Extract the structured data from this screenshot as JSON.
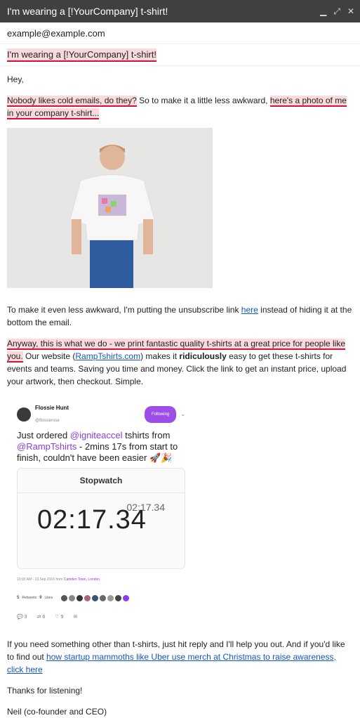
{
  "window": {
    "title": "I'm wearing a [!YourCompany] t-shirt!"
  },
  "to": {
    "value": "example@example.com"
  },
  "subject": {
    "value": "I'm wearing a [!YourCompany] t-shirt!"
  },
  "body": {
    "greeting": "Hey,",
    "p1_hl1": "Nobody likes cold emails, do they?",
    "p1_mid": " So to make it a little less awkward, ",
    "p1_hl2": "here's a photo of me in your company t-shirt...",
    "p2_a": "To make it even less awkward, I'm putting the unsubscribe link ",
    "p2_link": "here",
    "p2_b": " instead of hiding it at the bottom the email.",
    "p3_hl": "Anyway, this is what we do - we print fantastic quality t-shirts at a great price for people like you.",
    "p3_a": " Our website (",
    "p3_link": "RampTshirts.com",
    "p3_b": ") makes it ",
    "p3_bold": "ridiculously",
    "p3_c": " easy to get these t-shirts for events and teams. Saving you time and money. Click the link to get an instant price, upload your artwork, then checkout. Simple.",
    "p4_a": "If you need something other than t-shirts, just hit reply and I'll help you out. And if you'd like to find out ",
    "p4_link": "how startup mammoths like Uber use merch at Christmas to raise awareness, click here",
    "p5": "Thanks for listening!",
    "p6": "Neil (co-founder and CEO)"
  },
  "tweet": {
    "name": "Flossie Hunt",
    "handle": "@flossierose",
    "follow": "Following",
    "t1": "Just ordered ",
    "m1": "@igniteaccel",
    "t2": " tshirts from ",
    "m2": "@RampTshirts",
    "t3": " - 2mins 17s from start to finish, couldn't have been easier 🚀🎉",
    "sw_title": "Stopwatch",
    "sw_small": "02:17.34",
    "sw_big": "02:17.34",
    "meta_a": "10:00 AM - 13 Sep 2016 from ",
    "meta_loc": "Camden Town, London",
    "retweets_n": "5",
    "retweets_label": "Retweets",
    "likes_n": "9",
    "likes_label": "Likes",
    "replies": "3",
    "rts": "6",
    "hearts": "9"
  }
}
